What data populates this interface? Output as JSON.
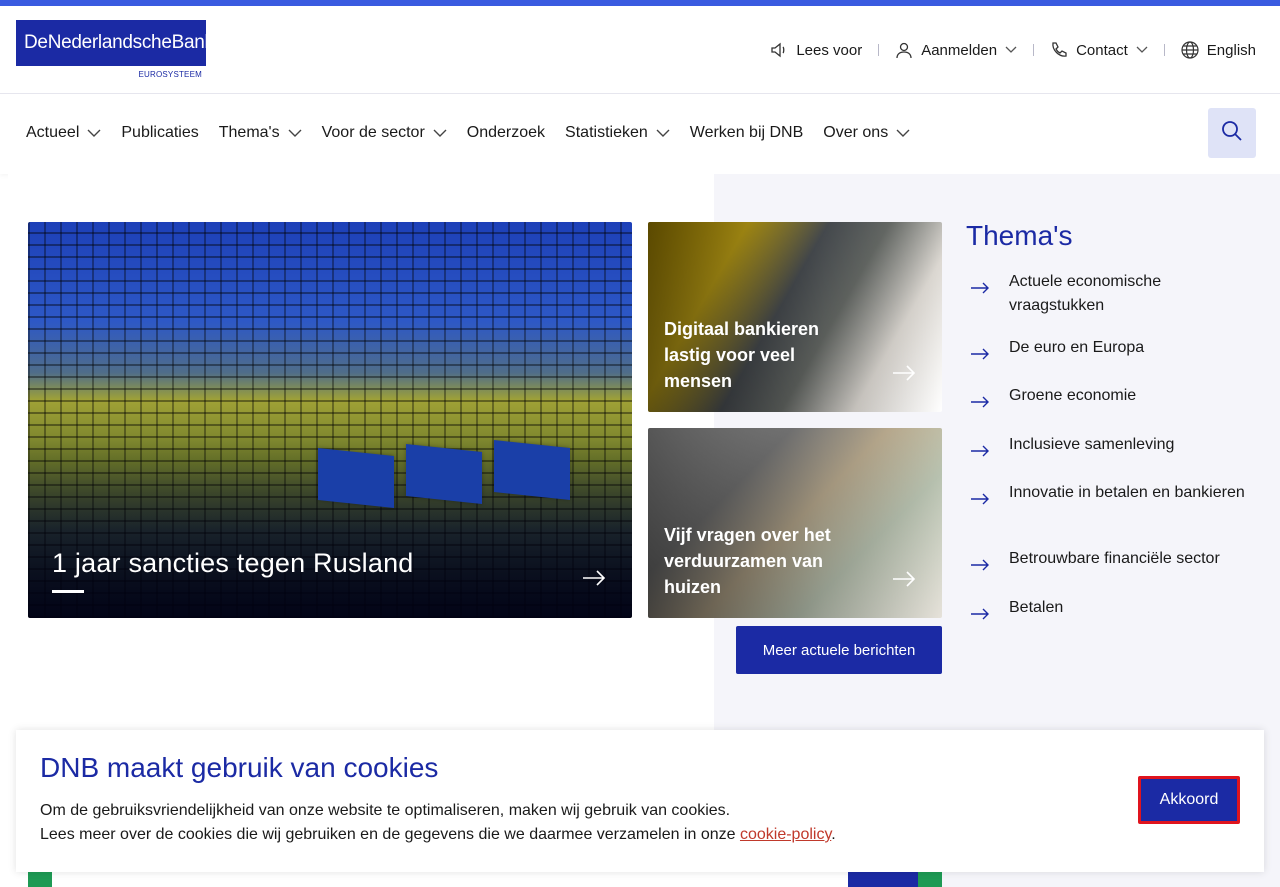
{
  "header": {
    "logo_text": "DeNederlandscheBank",
    "logo_sub": "EUROSYSTEEM",
    "utility": {
      "read_aloud": "Lees voor",
      "login": "Aanmelden",
      "contact": "Contact",
      "language": "English"
    }
  },
  "nav": {
    "items": [
      {
        "label": "Actueel",
        "dropdown": true
      },
      {
        "label": "Publicaties",
        "dropdown": false
      },
      {
        "label": "Thema's",
        "dropdown": true
      },
      {
        "label": "Voor de sector",
        "dropdown": true
      },
      {
        "label": "Onderzoek",
        "dropdown": false
      },
      {
        "label": "Statistieken",
        "dropdown": true
      },
      {
        "label": "Werken bij DNB",
        "dropdown": false
      },
      {
        "label": "Over ons",
        "dropdown": true
      }
    ]
  },
  "hero": {
    "title": "1 jaar sancties tegen Rusland"
  },
  "cards": [
    {
      "title": "Digitaal bankieren lastig voor veel mensen"
    },
    {
      "title": "Vijf vragen over het verduurzamen van huizen"
    }
  ],
  "more_button": "Meer actuele berichten",
  "themes": {
    "title": "Thema's",
    "items": [
      "Actuele economische vraagstukken",
      "De euro en Europa",
      "Groene economie",
      "Inclusieve samenleving",
      "Innovatie in betalen en bankieren",
      "Betrouwbare financiële sector",
      "Betalen"
    ]
  },
  "cookie": {
    "title": "DNB maakt gebruik van cookies",
    "line1": "Om de gebruiksvriendelijkheid van onze website te optimaliseren, maken wij gebruik van cookies.",
    "line2_prefix": "Lees meer over de cookies die wij gebruiken en de gegevens die we daarmee verzamelen in onze ",
    "link": "cookie-policy",
    "line2_suffix": ".",
    "accept": "Akkoord"
  },
  "colors": {
    "brand": "#1b2aa4",
    "accent_top": "#3a5be0",
    "link": "#c0392b",
    "focus": "#e0141e"
  }
}
